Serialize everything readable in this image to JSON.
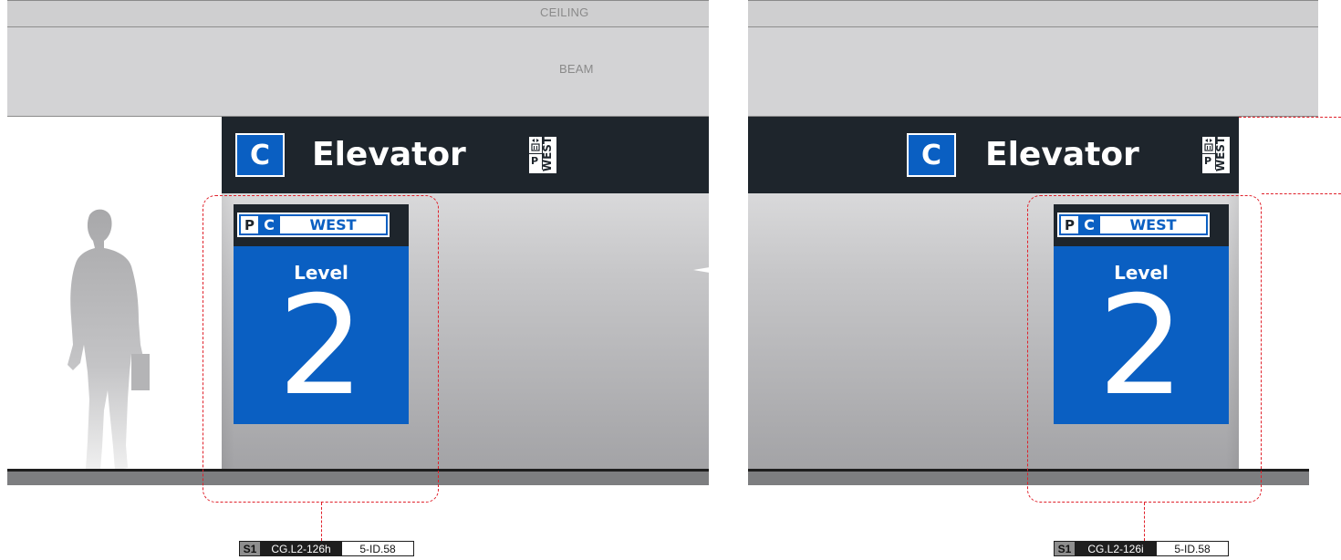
{
  "labels": {
    "ceiling": "CEILING",
    "beam": "BEAM"
  },
  "header_sign": {
    "letter": "C",
    "title": "Elevator",
    "icon_p": "P",
    "icon_direction": "WEST",
    "icon_name": "elevator-parking-west-icon"
  },
  "level_sign": {
    "tag_p": "P",
    "tag_c": "C",
    "tag_direction": "WEST",
    "level_word": "Level",
    "level_number": "2"
  },
  "codes": {
    "left": {
      "s": "S1",
      "code": "CG.L2-126h",
      "ref": "5-ID.58"
    },
    "right": {
      "s": "S1",
      "code": "CG.L2-126i",
      "ref": "5-ID.58"
    }
  },
  "colors": {
    "brand_blue": "#0a5fc2",
    "band_dark": "#1e252c",
    "callout_red": "#e0202a"
  }
}
